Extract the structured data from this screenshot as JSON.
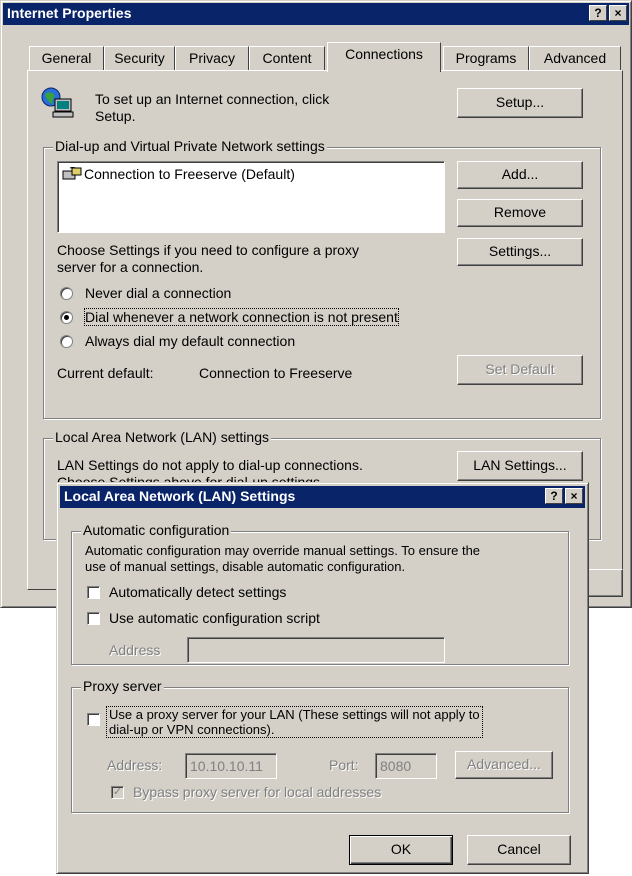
{
  "internet_properties": {
    "title": "Internet Properties",
    "help_label": "?",
    "close_label": "×",
    "tabs": [
      "General",
      "Security",
      "Privacy",
      "Content",
      "Connections",
      "Programs",
      "Advanced"
    ],
    "setup_text_line1": "To set up an Internet connection, click",
    "setup_text_line2": "Setup.",
    "setup_button": "Setup...",
    "dialup_group_label": "Dial-up and Virtual Private Network settings",
    "connections_list": [
      "Connection to Freeserve (Default)"
    ],
    "add_button": "Add...",
    "remove_button": "Remove",
    "proxy_text_line1": "Choose Settings if you need to configure a proxy",
    "proxy_text_line2": "server for a connection.",
    "settings_button": "Settings...",
    "radio_options": [
      {
        "label": "Never dial a connection",
        "selected": false
      },
      {
        "label": "Dial whenever a network connection is not present",
        "selected": true
      },
      {
        "label": "Always dial my default connection",
        "selected": false
      }
    ],
    "current_default_label": "Current default:",
    "current_default_value": "Connection to Freeserve",
    "set_default_button": "Set Default",
    "lan_group_label": "Local Area Network (LAN) settings",
    "lan_text_line1": "LAN Settings do not apply to dial-up connections.",
    "lan_text_line2": "Choose Settings above for dial-up settings.",
    "lan_settings_button": "LAN Settings..."
  },
  "lan_dialog": {
    "title": "Local Area Network (LAN) Settings",
    "help_label": "?",
    "close_label": "×",
    "auto_config_group": "Automatic configuration",
    "auto_config_desc_line1": "Automatic configuration may override manual settings.  To ensure the",
    "auto_config_desc_line2": "use of manual settings, disable automatic configuration.",
    "auto_detect_label": "Automatically detect settings",
    "auto_detect_checked": false,
    "auto_script_label": "Use automatic configuration script",
    "auto_script_checked": false,
    "address_label": "Address",
    "address_value": "",
    "proxy_group": "Proxy server",
    "use_proxy_line1": "Use a proxy server for your LAN (These settings will not apply to",
    "use_proxy_line2": "dial-up or VPN connections).",
    "use_proxy_checked": false,
    "proxy_address_label": "Address:",
    "proxy_address_value": "10.10.10.11",
    "port_label": "Port:",
    "port_value": "8080",
    "advanced_button": "Advanced...",
    "bypass_label": "Bypass proxy server for local addresses",
    "bypass_checked": true,
    "ok_button": "OK",
    "cancel_button": "Cancel"
  }
}
